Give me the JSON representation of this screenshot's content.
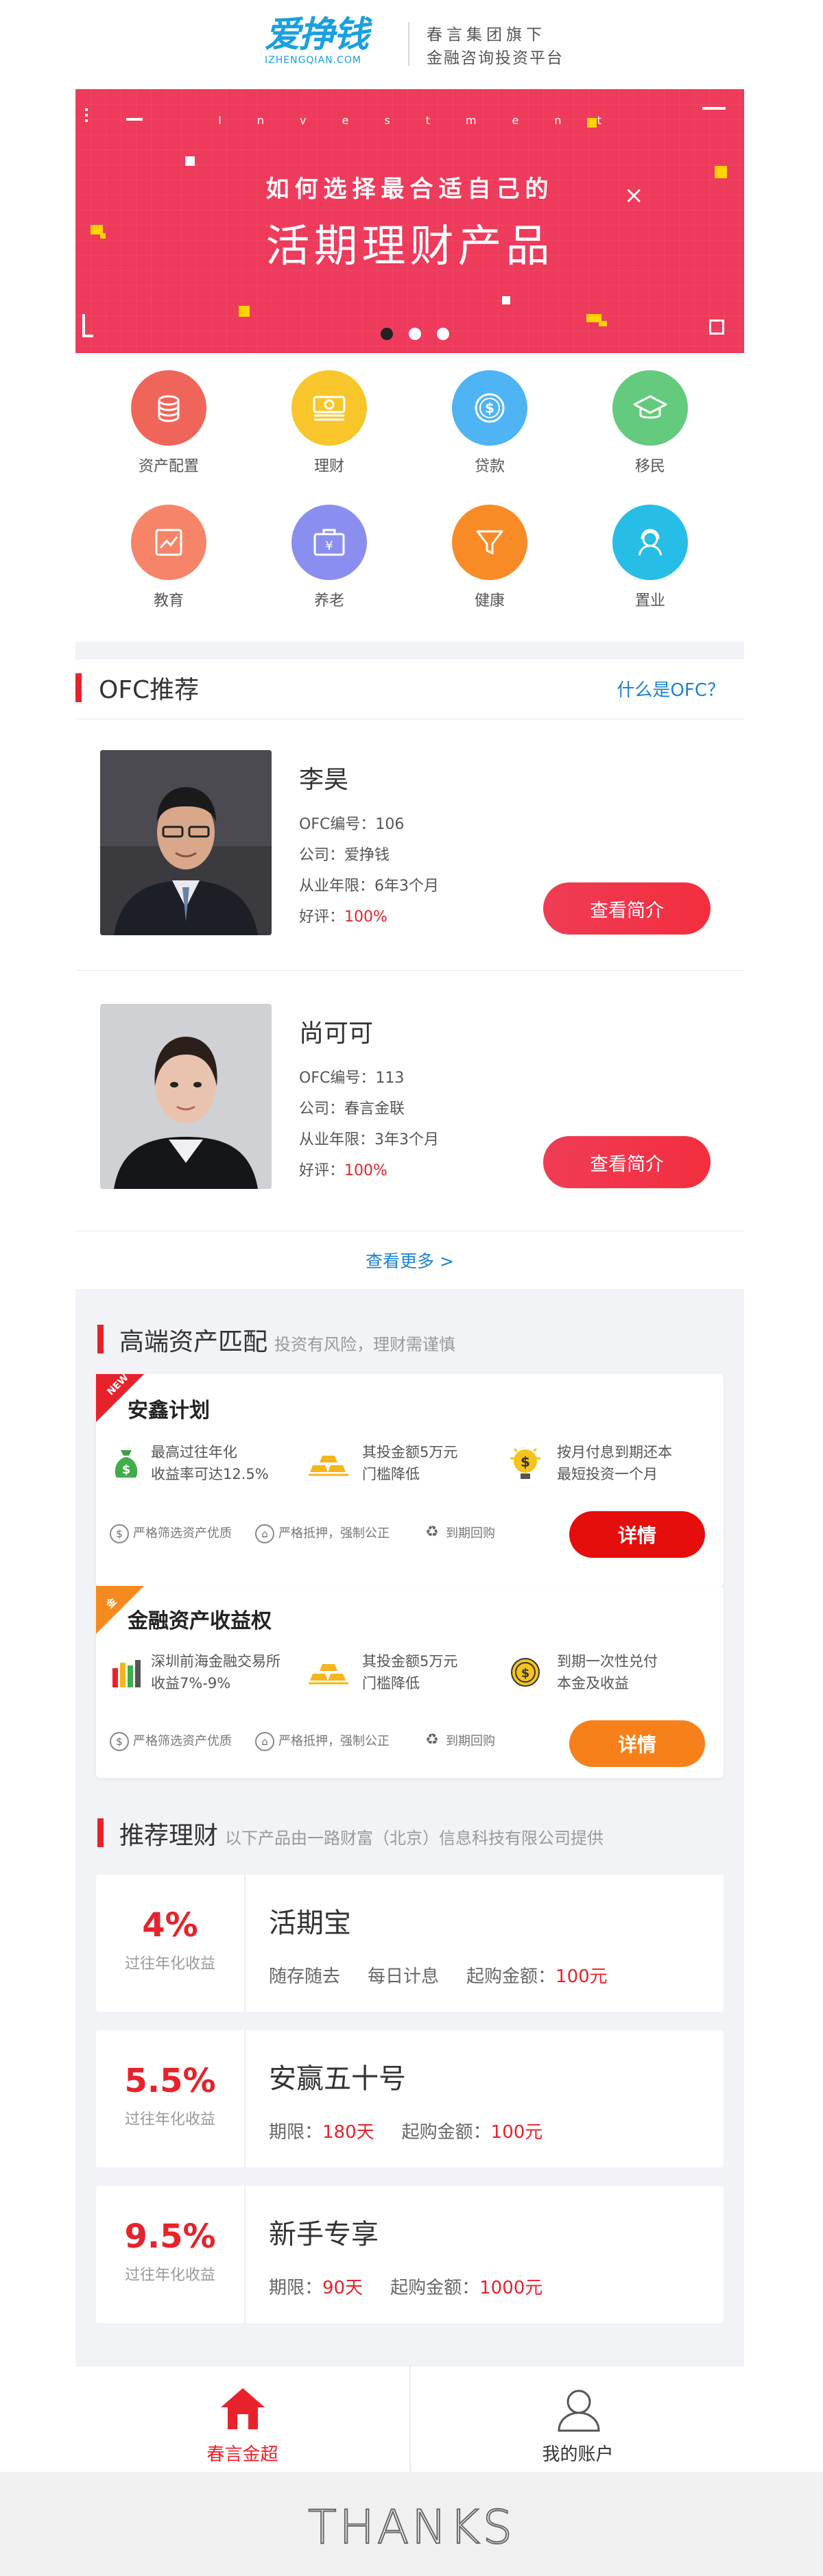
{
  "header": {
    "logo_cn": "爱挣钱",
    "logo_en": "IZHENGQIAN.COM",
    "slogan_line1": "春言集团旗下",
    "slogan_line2": "金融咨询投资平台"
  },
  "banner": {
    "eyebrow": "Investment",
    "subtitle": "如何选择最合适自己的",
    "title": "活期理财产品",
    "slide_count": 3,
    "active_slide": 1,
    "accent": "#ee3a5b"
  },
  "categories": [
    {
      "label": "资产配置",
      "icon": "coins-icon",
      "color": "#f0655a"
    },
    {
      "label": "理财",
      "icon": "money-stack-icon",
      "color": "#f8c62b"
    },
    {
      "label": "贷款",
      "icon": "dollar-coin-icon",
      "color": "#4fb4f3"
    },
    {
      "label": "移民",
      "icon": "graduation-cap-icon",
      "color": "#64ca7e"
    },
    {
      "label": "教育",
      "icon": "chart-icon",
      "color": "#f68469"
    },
    {
      "label": "养老",
      "icon": "yen-box-icon",
      "color": "#8a8fef"
    },
    {
      "label": "健康",
      "icon": "funnel-icon",
      "color": "#f98b26"
    },
    {
      "label": "置业",
      "icon": "agent-icon",
      "color": "#26bde6"
    }
  ],
  "ofc": {
    "title": "OFC推荐",
    "link": "什么是OFC？",
    "advisors": [
      {
        "name": "李昊",
        "id_label": "OFC编号：",
        "id": "106",
        "company_label": "公司：",
        "company": "爱挣钱",
        "years_label": "从业年限：",
        "years": "6年3个月",
        "rating_label": "好评：",
        "rating": "100%",
        "button": "查看简介"
      },
      {
        "name": "尚可可",
        "id_label": "OFC编号：",
        "id": "113",
        "company_label": "公司：",
        "company": "春言金联",
        "years_label": "从业年限：",
        "years": "3年3个月",
        "rating_label": "好评：",
        "rating": "100%",
        "button": "查看简介"
      }
    ],
    "more": "查看更多  >"
  },
  "premium": {
    "title": "高端资产匹配",
    "note": "投资有风险，理财需谨慎",
    "plans": [
      {
        "badge": "NEW",
        "badge_color": "#e8222b",
        "name": "安鑫计划",
        "features": [
          {
            "line1": "最高过往年化",
            "line2": "收益率可达12.5%",
            "icon": "money-bag-icon"
          },
          {
            "line1": "其投金额5万元",
            "line2": "门槛降低",
            "icon": "gold-bars-icon"
          },
          {
            "line1": "按月付息到期还本",
            "line2": "最短投资一个月",
            "icon": "coin-bulb-icon"
          }
        ],
        "guarantees": [
          "严格筛选资产优质",
          "严格抵押，强制公正",
          "到期回购"
        ],
        "button": "详情",
        "button_color": "#e60d0d"
      },
      {
        "badge": "金",
        "badge_color": "#f58a1f",
        "name": "金融资产收益权",
        "features": [
          {
            "line1": "深圳前海金融交易所",
            "line2": "收益7%-9%",
            "icon": "bar-chart-icon"
          },
          {
            "line1": "其投金额5万元",
            "line2": "门槛降低",
            "icon": "gold-bars-icon"
          },
          {
            "line1": "到期一次性兑付",
            "line2": "本金及收益",
            "icon": "gold-coin-icon"
          }
        ],
        "guarantees": [
          "严格筛选资产优质",
          "严格抵押，强制公正",
          "到期回购"
        ],
        "button": "详情",
        "button_color": "#f8801a"
      }
    ]
  },
  "recommend": {
    "title": "推荐理财",
    "note": "以下产品由一路财富（北京）信息科技有限公司提供",
    "products": [
      {
        "rate": "4%",
        "rate_label": "过往年化收益",
        "name": "活期宝",
        "d1": "随存随去",
        "d2": "每日计息",
        "d3_label": "起购金额：",
        "d3": "100元"
      },
      {
        "rate": "5.5%",
        "rate_label": "过往年化收益",
        "name": "安赢五十号",
        "d1_label": "期限：",
        "d1": "180天",
        "d3_label": "起购金额：",
        "d3": "100元"
      },
      {
        "rate": "9.5%",
        "rate_label": "过往年化收益",
        "name": "新手专享",
        "d1_label": "期限：",
        "d1": "90天",
        "d3_label": "起购金额：",
        "d3": "1000元"
      }
    ]
  },
  "tabbar": {
    "home": "春言金超",
    "account": "我的账户",
    "active_color": "#e8222b"
  },
  "footer": {
    "text": "THANKS"
  }
}
